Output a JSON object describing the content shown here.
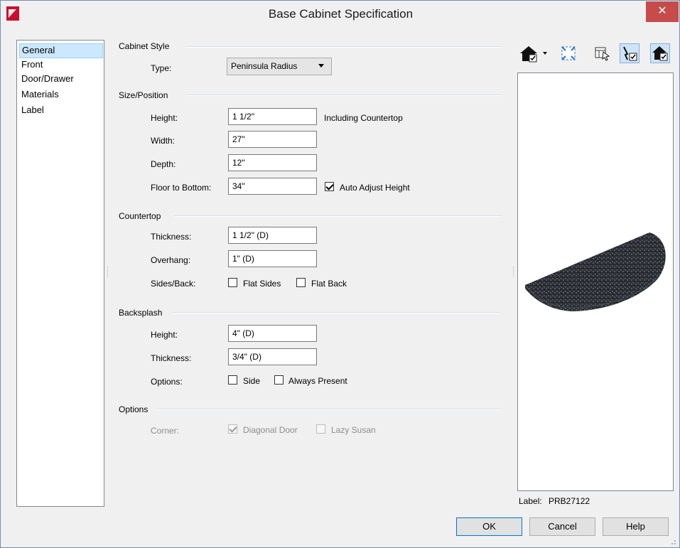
{
  "window": {
    "title": "Base Cabinet Specification",
    "close_glyph": "✕"
  },
  "nav": {
    "items": [
      {
        "label": "General",
        "selected": true
      },
      {
        "label": "Front"
      },
      {
        "label": "Door/Drawer"
      },
      {
        "label": "Materials"
      },
      {
        "label": "Label"
      }
    ]
  },
  "cabinet_style": {
    "title": "Cabinet Style",
    "type_label": "Type:",
    "type_value": "Peninsula Radius"
  },
  "size_position": {
    "title": "Size/Position",
    "height_label": "Height:",
    "height_value": "1 1/2\"",
    "height_note": "Including Countertop",
    "width_label": "Width:",
    "width_value": "27\"",
    "depth_label": "Depth:",
    "depth_value": "12\"",
    "floor_label": "Floor to Bottom:",
    "floor_value": "34\"",
    "auto_adjust_label": "Auto Adjust Height",
    "auto_adjust_checked": true
  },
  "countertop": {
    "title": "Countertop",
    "thickness_label": "Thickness:",
    "thickness_value": "1 1/2\" (D)",
    "overhang_label": "Overhang:",
    "overhang_value": "1\" (D)",
    "sides_back_label": "Sides/Back:",
    "flat_sides_label": "Flat Sides",
    "flat_back_label": "Flat Back"
  },
  "backsplash": {
    "title": "Backsplash",
    "height_label": "Height:",
    "height_value": "4\" (D)",
    "thickness_label": "Thickness:",
    "thickness_value": "3/4\" (D)",
    "options_label": "Options:",
    "side_label": "Side",
    "always_present_label": "Always Present"
  },
  "options": {
    "title": "Options",
    "corner_label": "Corner:",
    "diagonal_door_label": "Diagonal Door",
    "diagonal_door_checked": true,
    "lazy_susan_label": "Lazy Susan"
  },
  "preview": {
    "label_caption": "Label:",
    "label_value": "PRB27122",
    "toolbar_icons": [
      "camera-view-icon",
      "fill-window-icon",
      "select-objects-icon",
      "edit-objects-icon",
      "show-object-icon"
    ]
  },
  "buttons": {
    "ok": "OK",
    "cancel": "Cancel",
    "help": "Help"
  },
  "colors": {
    "accent": "#0078d7",
    "close": "#c74b4b",
    "nav_selected": "#cce8ff",
    "toolbar_blue": "#2b73c4"
  }
}
